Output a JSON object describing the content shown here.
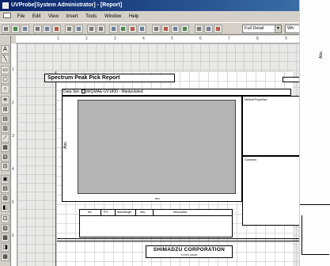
{
  "window": {
    "title": "UVProbe[System Administrator] - [Report]"
  },
  "menubar": {
    "items": [
      "File",
      "Edit",
      "View",
      "Insert",
      "Tools",
      "Window",
      "Help"
    ]
  },
  "toolbar": {
    "zoom_select": "Full Detail",
    "second_select": "Wh"
  },
  "ruler": {
    "h": [
      "1",
      "2",
      "3",
      "4",
      "5",
      "6",
      "7",
      "8",
      "9"
    ],
    "v": [
      "1",
      "2",
      "3",
      "4",
      "5",
      "6"
    ]
  },
  "report": {
    "title": "Spectrum Peak Pick Report",
    "data_set_label": "Data Set:",
    "data_set_value": "M/QMAE-UV1800 - Manipulated",
    "y_axis_label": "Abs.",
    "x_axis_label": "nm",
    "method_panel_label": "Method Properties",
    "comment_panel_label": "Comment",
    "peak_table_headers": [
      "No.",
      "P/V",
      "Wavelength",
      "Abs.",
      "Description"
    ],
    "footer_company": "SHIMADZU CORPORATION",
    "footer_sub": "KYOTO JAPAN"
  },
  "sheet": {
    "axis_label": "Abs."
  }
}
